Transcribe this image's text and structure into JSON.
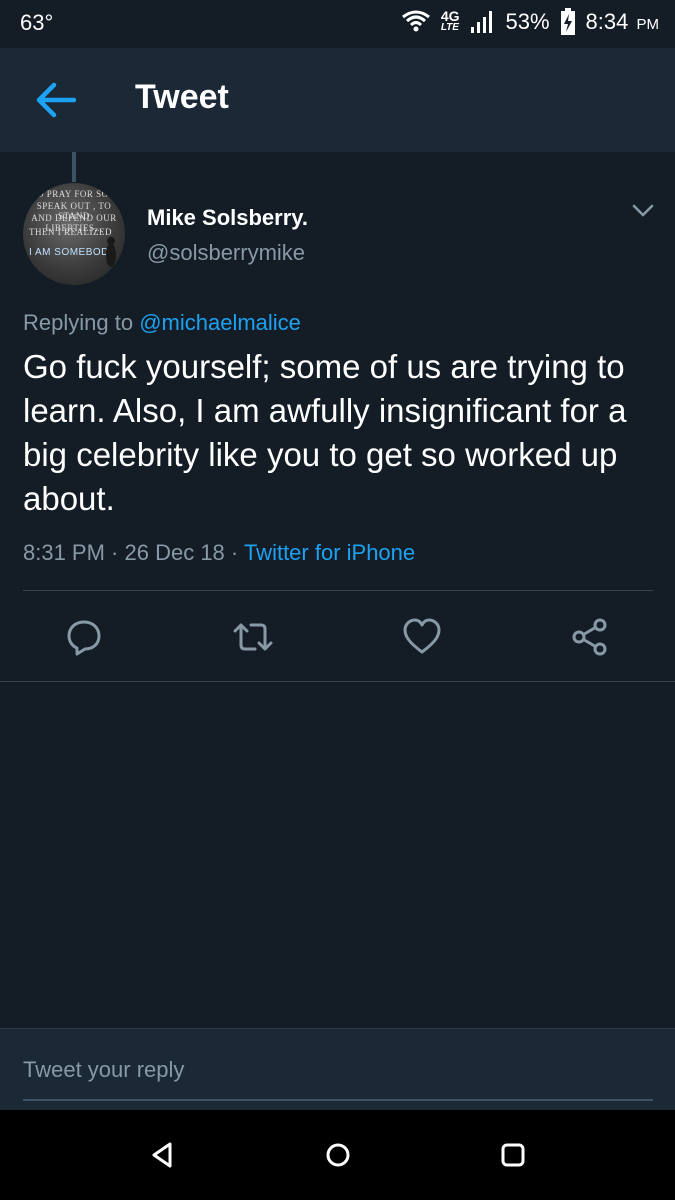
{
  "status_bar": {
    "temperature": "63°",
    "network": "4G",
    "network_sub": "LTE",
    "battery": "53%",
    "time": "8:34",
    "ampm": "PM"
  },
  "app_bar": {
    "title": "Tweet",
    "back_icon": "arrow-left-icon"
  },
  "tweet": {
    "avatar_text": [
      "TO PRAY FOR SO...",
      "SPEAK OUT , TO STAND",
      "AND DEFEND OUR LIBERTIES...",
      "THEN I REALIZED",
      "I AM SOMEBODY"
    ],
    "display_name": "Mike Solsberry.",
    "handle": "@solsberrymike",
    "replying_to_label": "Replying to",
    "replying_to_handle": "@michaelmalice",
    "text": "Go fuck yourself; some of us are trying to learn. Also, I am awfully insignificant for a big celebrity like you to get so worked up about.",
    "time": "8:31 PM",
    "date": "26 Dec 18",
    "source": "Twitter for iPhone",
    "separator": " · "
  },
  "actions": [
    "reply-icon",
    "retweet-icon",
    "like-icon",
    "share-icon"
  ],
  "reply_bar": {
    "placeholder": "Tweet your reply"
  },
  "nav_bar": [
    "back-nav-icon",
    "home-nav-icon",
    "recents-nav-icon"
  ],
  "colors": {
    "background": "#141d26",
    "app_bar": "#1b2836",
    "accent": "#1da1f2",
    "secondary_text": "#8899a6"
  }
}
